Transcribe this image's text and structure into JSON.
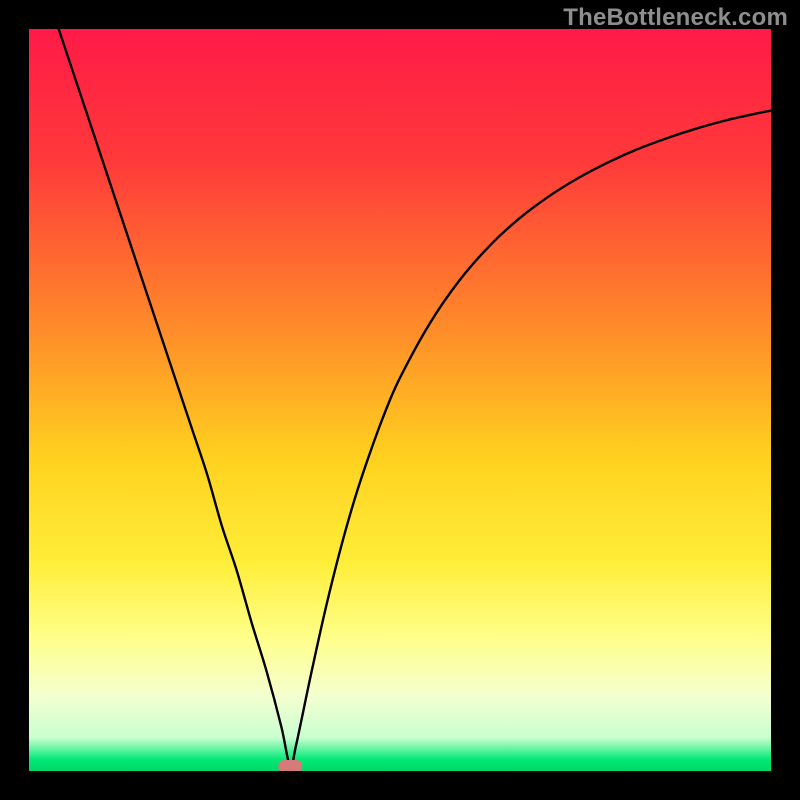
{
  "watermark": "TheBottleneck.com",
  "chart_data": {
    "type": "line",
    "title": "",
    "xlabel": "",
    "ylabel": "",
    "xlim": [
      0,
      100
    ],
    "ylim": [
      0,
      100
    ],
    "background_gradient": [
      {
        "pos": 0.0,
        "color": "#ff1a47"
      },
      {
        "pos": 0.18,
        "color": "#ff3a3a"
      },
      {
        "pos": 0.4,
        "color": "#ff8a2a"
      },
      {
        "pos": 0.58,
        "color": "#ffd21f"
      },
      {
        "pos": 0.72,
        "color": "#ffee3a"
      },
      {
        "pos": 0.82,
        "color": "#ffff8a"
      },
      {
        "pos": 0.9,
        "color": "#f4ffd0"
      },
      {
        "pos": 0.955,
        "color": "#c9ffd0"
      },
      {
        "pos": 0.985,
        "color": "#00e876"
      },
      {
        "pos": 1.0,
        "color": "#00d868"
      }
    ],
    "curve": {
      "description": "V-shaped bottleneck curve: plunges from top-left to a minimum marker, then curves up toward upper-right",
      "x": [
        4,
        6,
        8,
        10,
        12,
        14,
        16,
        18,
        20,
        22,
        24,
        26,
        28,
        30,
        32,
        34,
        35.2,
        36,
        38,
        40,
        42,
        44,
        46,
        48,
        50,
        54,
        58,
        62,
        66,
        70,
        74,
        78,
        82,
        86,
        90,
        94,
        98,
        100
      ],
      "y": [
        100,
        94,
        88,
        82,
        76,
        70,
        64,
        58,
        52,
        46,
        40,
        33,
        27,
        20,
        13.5,
        6,
        0.6,
        3.5,
        13,
        22,
        30,
        37,
        43,
        48.4,
        53,
        60.3,
        66.1,
        70.7,
        74.4,
        77.4,
        79.9,
        82,
        83.8,
        85.3,
        86.6,
        87.7,
        88.6,
        89
      ]
    },
    "marker": {
      "x": 35.2,
      "y": 0.6,
      "color": "#d97a7a",
      "shape": "rounded-rect"
    }
  }
}
